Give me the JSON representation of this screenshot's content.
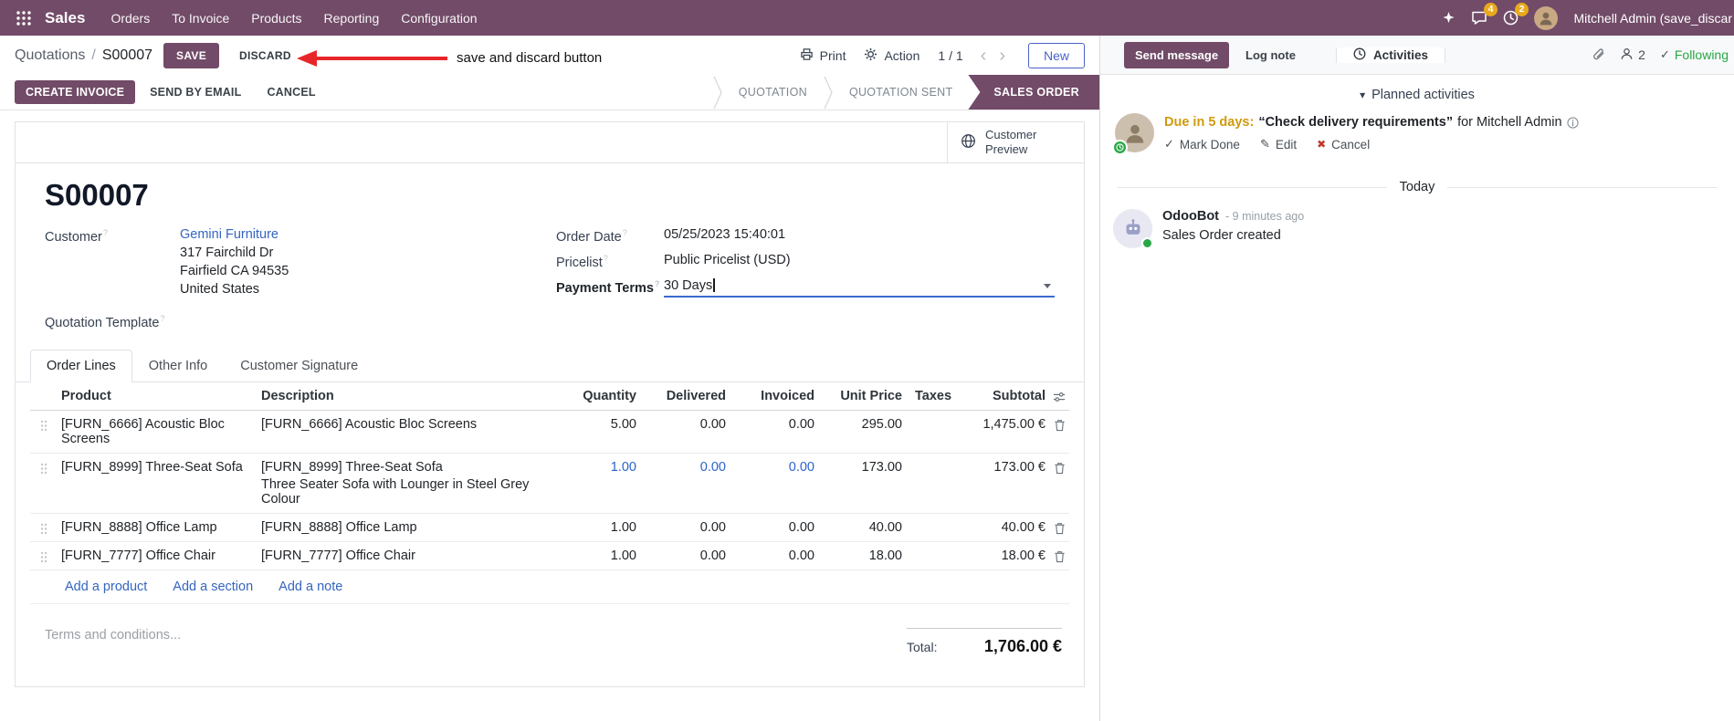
{
  "colors": {
    "brand": "#714B67",
    "link": "#3565c0",
    "annotation_red": "#e8262a",
    "following_green": "#28a745",
    "activity_due": "#cf9a0c"
  },
  "navbar": {
    "app_name": "Sales",
    "menus": [
      "Orders",
      "To Invoice",
      "Products",
      "Reporting",
      "Configuration"
    ],
    "message_badge": "4",
    "activity_badge": "2",
    "user_name": "Mitchell Admin (save_discar"
  },
  "control_panel": {
    "breadcrumb_parent": "Quotations",
    "breadcrumb_separator": "/",
    "breadcrumb_current": "S00007",
    "save_label": "SAVE",
    "discard_label": "DISCARD",
    "print_label": "Print",
    "action_label": "Action",
    "pager": "1 / 1",
    "prev_label": "‹",
    "next_label": "›",
    "new_label": "New"
  },
  "annotation": {
    "text": "save and discard button"
  },
  "statusbar": {
    "create_invoice": "CREATE INVOICE",
    "send_by_email": "SEND BY EMAIL",
    "cancel": "CANCEL",
    "stages": [
      "QUOTATION",
      "QUOTATION SENT",
      "SALES ORDER"
    ],
    "active_stage": "SALES ORDER"
  },
  "sheet": {
    "customer_preview": "Customer Preview",
    "name": "S00007",
    "help_marker": "?",
    "customer": {
      "label": "Customer",
      "name": "Gemini Furniture",
      "street": "317 Fairchild Dr",
      "city": "Fairfield CA 94535",
      "country": "United States"
    },
    "quotation_template_label": "Quotation Template",
    "order_date": {
      "label": "Order Date",
      "value": "05/25/2023 15:40:01"
    },
    "pricelist": {
      "label": "Pricelist",
      "value": "Public Pricelist (USD)"
    },
    "payment_terms": {
      "label": "Payment Terms",
      "value": "30 Days"
    },
    "tabs": [
      "Order Lines",
      "Other Info",
      "Customer Signature"
    ],
    "order_lines": {
      "headers": {
        "product": "Product",
        "description": "Description",
        "quantity": "Quantity",
        "delivered": "Delivered",
        "invoiced": "Invoiced",
        "unit_price": "Unit Price",
        "taxes": "Taxes",
        "subtotal": "Subtotal"
      },
      "rows": [
        {
          "product": "[FURN_6666] Acoustic Bloc Screens",
          "description": "[FURN_6666] Acoustic Bloc Screens",
          "quantity": "5.00",
          "delivered": "0.00",
          "invoiced": "0.00",
          "unit_price": "295.00",
          "subtotal": "1,475.00 €"
        },
        {
          "product": "[FURN_8999] Three-Seat Sofa",
          "description": "[FURN_8999] Three-Seat Sofa",
          "description_extra": "Three Seater Sofa with Lounger in Steel Grey Colour",
          "quantity": "1.00",
          "delivered": "0.00",
          "invoiced": "0.00",
          "unit_price": "173.00",
          "subtotal": "173.00 €"
        },
        {
          "product": "[FURN_8888] Office Lamp",
          "description": "[FURN_8888] Office Lamp",
          "quantity": "1.00",
          "delivered": "0.00",
          "invoiced": "0.00",
          "unit_price": "40.00",
          "subtotal": "40.00 €"
        },
        {
          "product": "[FURN_7777] Office Chair",
          "description": "[FURN_7777] Office Chair",
          "quantity": "1.00",
          "delivered": "0.00",
          "invoiced": "0.00",
          "unit_price": "18.00",
          "subtotal": "18.00 €"
        }
      ],
      "add_product": "Add a product",
      "add_section": "Add a section",
      "add_note": "Add a note"
    },
    "terms_placeholder": "Terms and conditions...",
    "total_label": "Total:",
    "total_value": "1,706.00 €"
  },
  "chatter": {
    "send_message": "Send message",
    "log_note": "Log note",
    "activities_tab": "Activities",
    "followers_count": "2",
    "following": "Following",
    "planned_header": "Planned activities",
    "activity": {
      "due": "Due in 5 days:",
      "summary": "“Check delivery requirements”",
      "assignee": "for Mitchell Admin",
      "mark_done": "Mark Done",
      "edit": "Edit",
      "cancel": "Cancel"
    },
    "date_separator": "Today",
    "message": {
      "author": "OdooBot",
      "time": "- 9 minutes ago",
      "body": "Sales Order created"
    }
  }
}
